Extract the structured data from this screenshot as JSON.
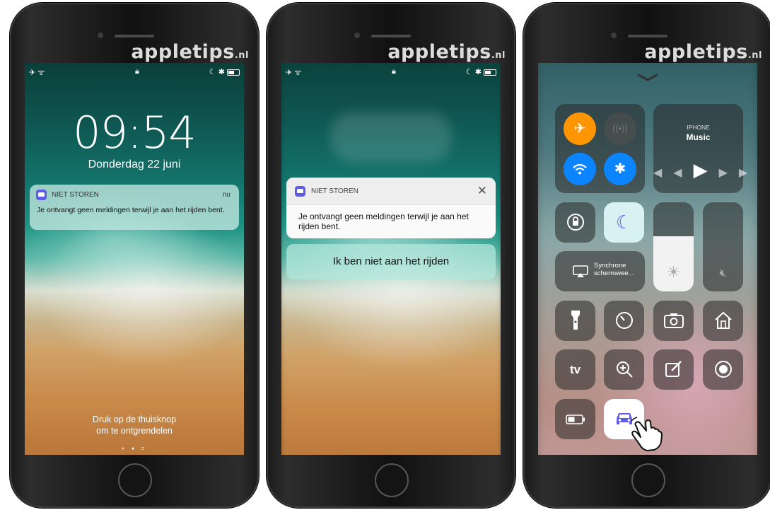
{
  "brand": {
    "name": "appletips",
    "suffix": ".nl"
  },
  "lockscreen": {
    "time": "09:54",
    "date": "Donderdag 22 juni",
    "notification": {
      "app": "NIET STOREN",
      "time": "nu",
      "body": "Je ontvangt geen meldingen terwijl je aan het rijden bent."
    },
    "unlock_line1": "Druk op de thuisknop",
    "unlock_line2": "om te ontgrendelen"
  },
  "expanded": {
    "notification": {
      "app": "NIET STOREN",
      "body": "Je ontvangt geen meldingen terwijl je aan het rijden bent."
    },
    "action_label": "Ik ben niet aan het rijden"
  },
  "control_center": {
    "music": {
      "device": "IPHONE",
      "title": "Music"
    },
    "mirroring_line1": "Synchrone",
    "mirroring_line2": "schermwee...",
    "brightness_level": 0.62,
    "appletv_label": "tv"
  }
}
